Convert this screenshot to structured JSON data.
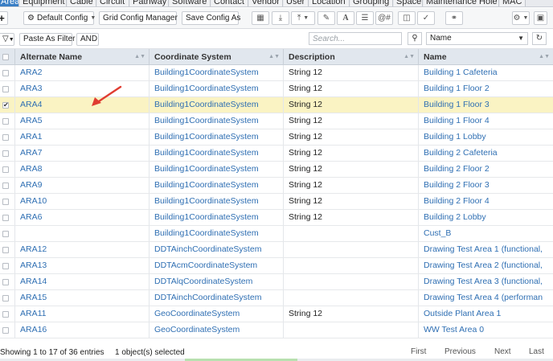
{
  "tabs": [
    {
      "label": "Area",
      "active": true
    },
    {
      "label": "Equipment"
    },
    {
      "label": "Cable"
    },
    {
      "label": "Circuit"
    },
    {
      "label": "Pathway"
    },
    {
      "label": "Software"
    },
    {
      "label": "Contact"
    },
    {
      "label": "Vendor"
    },
    {
      "label": "User"
    },
    {
      "label": "Location"
    },
    {
      "label": "Grouping"
    },
    {
      "label": "Space"
    },
    {
      "label": "Maintenance Hole"
    },
    {
      "label": "MAC"
    }
  ],
  "toolbar": {
    "add_label": "+",
    "default_config_label": "Default Config",
    "grid_config_label": "Grid Config Manager",
    "save_config_label": "Save Config As"
  },
  "filterbar": {
    "paste_filter_label": "Paste As Filter",
    "and_label": "AND",
    "search_placeholder": "Search...",
    "field_select_value": "Name"
  },
  "grid": {
    "columns": [
      "Alternate Name",
      "Coordinate System",
      "Description",
      "Name"
    ],
    "rows": [
      {
        "alt": "ARA2",
        "coord": "Building1CoordinateSystem",
        "desc": "String 12",
        "name": "Building 1 Cafeteria",
        "checked": false
      },
      {
        "alt": "ARA3",
        "coord": "Building1CoordinateSystem",
        "desc": "String 12",
        "name": "Building 1 Floor 2",
        "checked": false
      },
      {
        "alt": "ARA4",
        "coord": "Building1CoordinateSystem",
        "desc": "String 12",
        "name": "Building 1 Floor 3",
        "checked": true
      },
      {
        "alt": "ARA5",
        "coord": "Building1CoordinateSystem",
        "desc": "String 12",
        "name": "Building 1 Floor 4",
        "checked": false
      },
      {
        "alt": "ARA1",
        "coord": "Building1CoordinateSystem",
        "desc": "String 12",
        "name": "Building 1 Lobby",
        "checked": false
      },
      {
        "alt": "ARA7",
        "coord": "Building1CoordinateSystem",
        "desc": "String 12",
        "name": "Building 2 Cafeteria",
        "checked": false
      },
      {
        "alt": "ARA8",
        "coord": "Building1CoordinateSystem",
        "desc": "String 12",
        "name": "Building 2 Floor 2",
        "checked": false
      },
      {
        "alt": "ARA9",
        "coord": "Building1CoordinateSystem",
        "desc": "String 12",
        "name": "Building 2 Floor 3",
        "checked": false
      },
      {
        "alt": "ARA10",
        "coord": "Building1CoordinateSystem",
        "desc": "String 12",
        "name": "Building 2 Floor 4",
        "checked": false
      },
      {
        "alt": "ARA6",
        "coord": "Building1CoordinateSystem",
        "desc": "String 12",
        "name": "Building 2 Lobby",
        "checked": false
      },
      {
        "alt": "",
        "coord": "Building1CoordinateSystem",
        "desc": "",
        "name": "Cust_B",
        "checked": false
      },
      {
        "alt": "ARA12",
        "coord": "DDTAinchCoordinateSystem",
        "desc": "",
        "name": "Drawing Test Area 1 (functional,",
        "checked": false
      },
      {
        "alt": "ARA13",
        "coord": "DDTAcmCoordinateSystem",
        "desc": "",
        "name": "Drawing Test Area 2 (functional,",
        "checked": false
      },
      {
        "alt": "ARA14",
        "coord": "DDTAlqCoordinateSystem",
        "desc": "",
        "name": "Drawing Test Area 3 (functional,",
        "checked": false
      },
      {
        "alt": "ARA15",
        "coord": "DDTAinchCoordinateSystem",
        "desc": "",
        "name": "Drawing Test Area 4 (performan",
        "checked": false
      },
      {
        "alt": "ARA11",
        "coord": "GeoCoordinateSystem",
        "desc": "String 12",
        "name": "Outside Plant Area 1",
        "checked": false
      },
      {
        "alt": "ARA16",
        "coord": "GeoCoordinateSystem",
        "desc": "",
        "name": "WW Test Area 0",
        "checked": false
      }
    ]
  },
  "footer": {
    "info": "Showing 1 to 17 of 36 entries",
    "selected": "1 object(s) selected",
    "first": "First",
    "previous": "Previous",
    "next": "Next",
    "last": "Last"
  },
  "colors": {
    "accent": "#3a7fc5",
    "link": "#2f6fb3",
    "selected_row": "#faf3c3",
    "annotation_arrow": "#e03c31"
  }
}
